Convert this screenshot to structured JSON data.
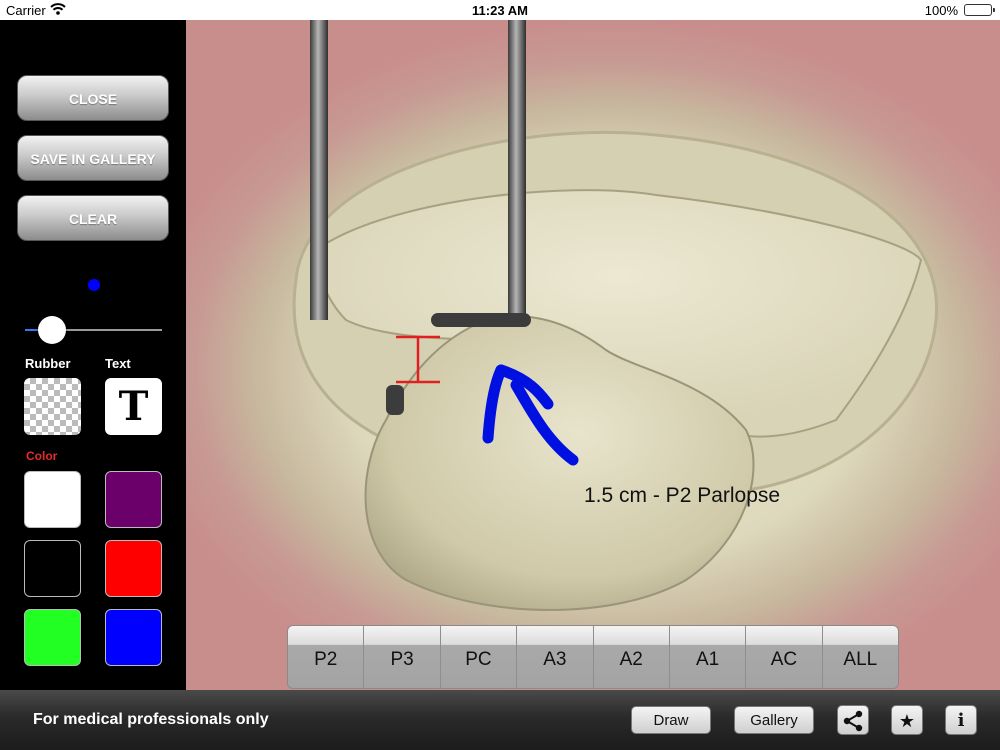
{
  "status_bar": {
    "carrier": "Carrier",
    "time": "11:23 AM",
    "battery": "100%",
    "wifi_icon": "wifi-icon",
    "battery_icon": "battery-icon"
  },
  "sidebar": {
    "close_label": "CLOSE",
    "save_label": "SAVE IN GALLERY",
    "clear_label": "CLEAR",
    "brush_color": "#0000ff",
    "brush_size_fraction": 0.2,
    "rubber_label": "Rubber",
    "text_label": "Text",
    "text_tool_glyph": "T",
    "color_label": "Color",
    "colors": [
      "#ffffff",
      "#6b006b",
      "#000000",
      "#ff0000",
      "#22ff22",
      "#0000ff"
    ]
  },
  "canvas": {
    "annotation_text": "1.5 cm - P2 Parlopse",
    "arrow_color": "#0010e0",
    "marker_color": "#e02020"
  },
  "segments": [
    "P2",
    "P3",
    "PC",
    "A3",
    "A2",
    "A1",
    "AC",
    "ALL"
  ],
  "bottom_bar": {
    "disclaimer": "For medical professionals only",
    "draw_label": "Draw",
    "gallery_label": "Gallery",
    "share_icon": "share-icon",
    "star_icon": "star-icon",
    "info_icon": "info-icon",
    "info_glyph": "i"
  }
}
